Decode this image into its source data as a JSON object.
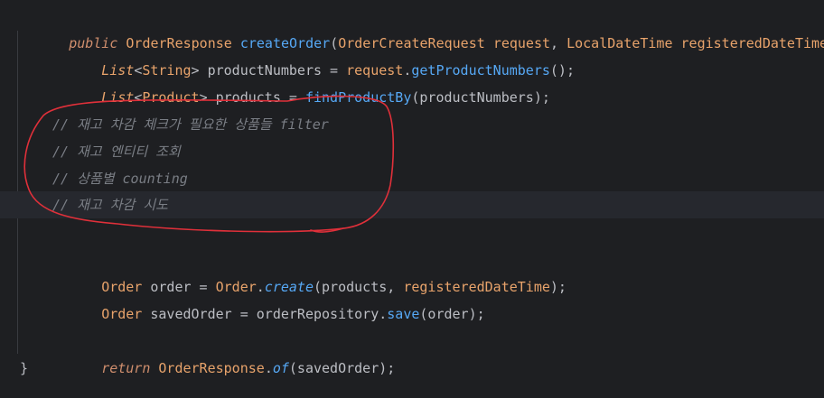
{
  "lines": {
    "l1": {
      "public": "public ",
      "ret": "OrderResponse ",
      "fn": "createOrder",
      "open": "(",
      "t1": "OrderCreateRequest ",
      "p1": "request",
      "comma": ", ",
      "t2": "LocalDateTime ",
      "p2": "registeredDateTime",
      "close": ") {"
    },
    "l2": {
      "t": "List",
      "lt": "<",
      "g": "String",
      "gt": "> ",
      "v": "productNumbers = ",
      "r": "request",
      "dot": ".",
      "m": "getProductNumbers",
      "end": "();"
    },
    "l3": {
      "t": "List",
      "lt": "<",
      "g": "Product",
      "gt": "> ",
      "v": "products = ",
      "m": "findProductBy",
      "arg": "(productNumbers);"
    },
    "c1": "// 재고 차감 체크가 필요한 상품들 filter",
    "c2": "// 재고 엔티티 조회",
    "c3": "// 상품별 counting",
    "c4": "// 재고 차감 시도",
    "l8": {
      "t": "Order ",
      "v": "order = ",
      "cls": "Order",
      "dot": ".",
      "m": "create",
      "open": "(products, ",
      "p": "registeredDateTime",
      "close": ");"
    },
    "l9": {
      "t": "Order ",
      "v": "savedOrder = ",
      "r": "orderRepository",
      "dot": ".",
      "m": "save",
      "arg": "(order);"
    },
    "l11": {
      "kw": "return ",
      "cls": "OrderResponse",
      "dot": ".",
      "m": "of",
      "arg": "(savedOrder);"
    },
    "l12": "}"
  },
  "colors": {
    "background": "#1e1f22",
    "keyword": "#cf8e6d",
    "function": "#56a8f5",
    "parameter": "#e8a36b",
    "comment": "#7a7e85",
    "annotation": "#e0303a"
  }
}
